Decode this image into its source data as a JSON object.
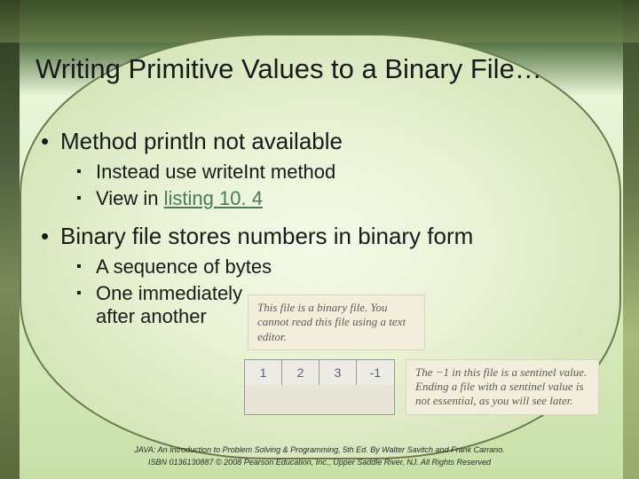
{
  "title": "Writing Primitive Values to a Binary File…",
  "bullets": {
    "b1": "Method println not available",
    "b1a": "Instead use writeInt method",
    "b1b_prefix": "View in ",
    "b1b_link": "listing 10. 4",
    "b2": "Binary file stores numbers in binary form",
    "b2a": "A sequence of bytes",
    "b2b": "One immediately after another"
  },
  "notes": {
    "top": "This file is a binary file. You cannot read this file using a text editor.",
    "right": "The −1 in this file is a sentinel value. Ending a file with a sentinel value is not essential, as you will see later."
  },
  "bytes": [
    "1",
    "2",
    "3",
    "-1"
  ],
  "footer": {
    "line1": "JAVA: An Introduction to Problem Solving & Programming, 5th Ed. By Walter Savitch and Frank Carrano.",
    "line2": "ISBN 0136130887 © 2008 Pearson Education, Inc., Upper Saddle River, NJ. All Rights Reserved"
  }
}
